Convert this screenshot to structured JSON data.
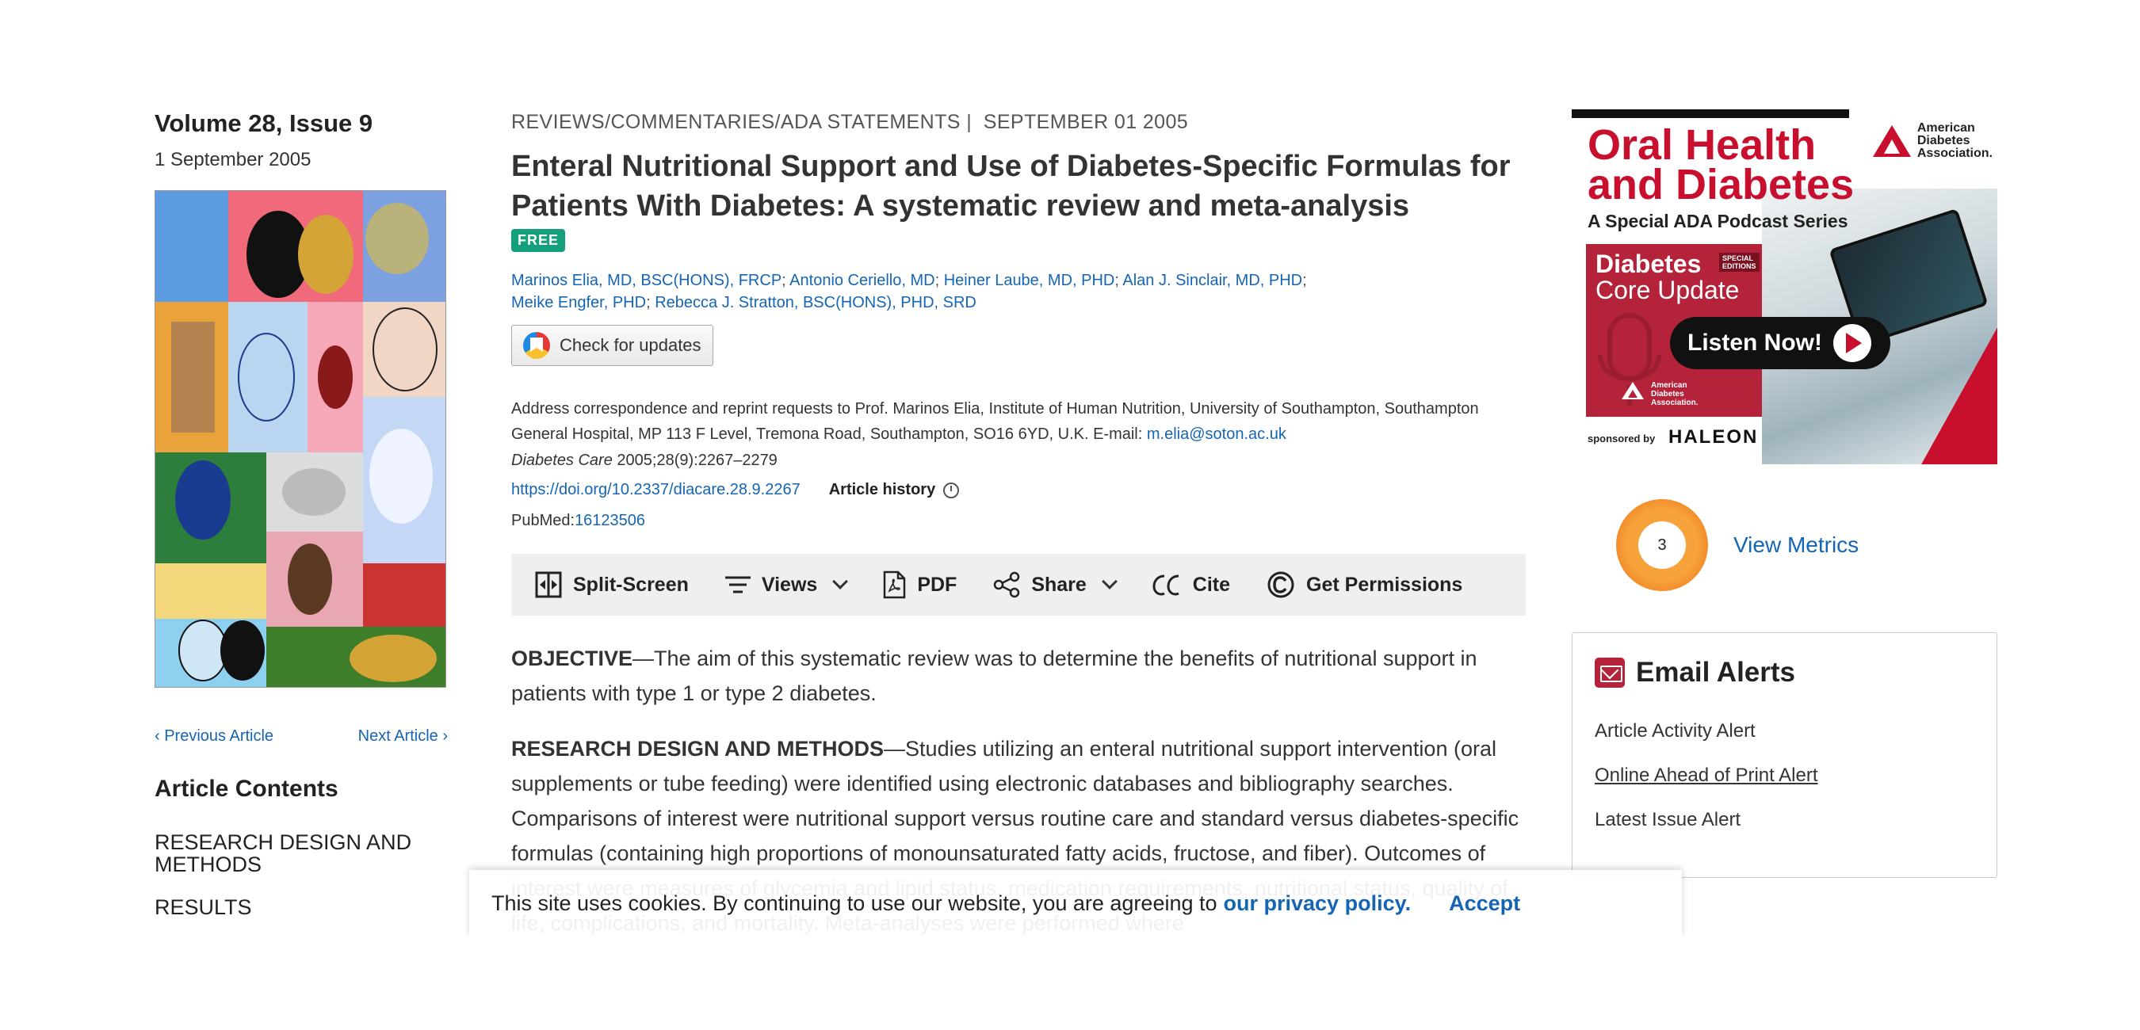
{
  "issue": {
    "volume_title": "Volume 28, Issue 9",
    "date": "1 September 2005",
    "cover_alt": "Journal cover",
    "previous": "Previous Article",
    "next": "Next Article",
    "contents_heading": "Article Contents",
    "contents": [
      "RESEARCH DESIGN AND METHODS",
      "RESULTS"
    ]
  },
  "article": {
    "category": "REVIEWS/COMMENTARIES/ADA STATEMENTS",
    "date": "SEPTEMBER 01 2005",
    "title": "Enteral Nutritional Support and Use of Diabetes-Specific Formulas for Patients With Diabetes: A systematic review and meta-analysis",
    "badge": "FREE",
    "authors": [
      "Marinos Elia, MD, BSC(HONS), FRCP",
      "Antonio Ceriello, MD",
      "Heiner Laube, MD, PHD",
      "Alan J. Sinclair, MD, PHD",
      "Meike Engfer, PHD",
      "Rebecca J. Stratton, BSC(HONS), PHD, SRD"
    ],
    "check_updates": "Check for updates",
    "address": "Address correspondence and reprint requests to Prof. Marinos Elia, Institute of Human Nutrition, University of Southampton, Southampton General Hospital, MP 113 F Level, Tremona Road, Southampton, SO16 6YD, U.K. E-mail:",
    "email": "m.elia@soton.ac.uk",
    "journal": "Diabetes Care",
    "citation": "2005;28(9):2267–2279",
    "doi": "https://doi.org/10.2337/diacare.28.9.2267",
    "history": "Article history",
    "pubmed_label": "PubMed:",
    "pubmed_id": "16123506"
  },
  "toolbar": {
    "split": "Split-Screen",
    "views": "Views",
    "pdf": "PDF",
    "share": "Share",
    "cite": "Cite",
    "permissions": "Get Permissions"
  },
  "abstract": {
    "objective_label": "OBJECTIVE",
    "objective_text": "—The aim of this systematic review was to determine the benefits of nutritional support in patients with type 1 or type 2 diabetes.",
    "methods_label": "RESEARCH DESIGN AND METHODS",
    "methods_text": "—Studies utilizing an enteral nutritional support intervention (oral supplements or tube feeding) were identified using electronic databases and bibliography searches. Comparisons of interest were nutritional support versus routine care and standard versus diabetes-specific formulas (containing high proportions of monounsaturated fatty acids, fructose, and fiber). Outcomes of interest were measures of glycemia and lipid status, medication requirements, nutritional status, quality of life, complications, and mortality. Meta-analyses were performed where"
  },
  "ad": {
    "headline_1": "Oral Health",
    "headline_2": "and Diabetes",
    "ada_1": "American",
    "ada_2": "Diabetes",
    "ada_3": "Association.",
    "subtitle": "A Special ADA Podcast Series",
    "dcu_1": "Diabetes",
    "dcu_2": "Core Update",
    "special_1": "SPECIAL",
    "special_2": "EDITIONS",
    "listen": "Listen Now!",
    "small_logo_1": "American",
    "small_logo_2": "Diabetes",
    "small_logo_3": "Association.",
    "sponsored": "sponsored by",
    "sponsor": "HALEON"
  },
  "metrics": {
    "count": "3",
    "label": "View Metrics"
  },
  "alerts": {
    "heading": "Email Alerts",
    "items": [
      "Article Activity Alert",
      "Online Ahead of Print Alert",
      "Latest Issue Alert"
    ]
  },
  "cookie": {
    "text": "This site uses cookies. By continuing to use our website, you are agreeing to",
    "policy": "our privacy policy.",
    "accept": "Accept"
  },
  "colors": {
    "link": "#1565b5",
    "free_badge": "#13a07a",
    "ad_red": "#c8102e",
    "alert_icon": "#b5233a"
  }
}
